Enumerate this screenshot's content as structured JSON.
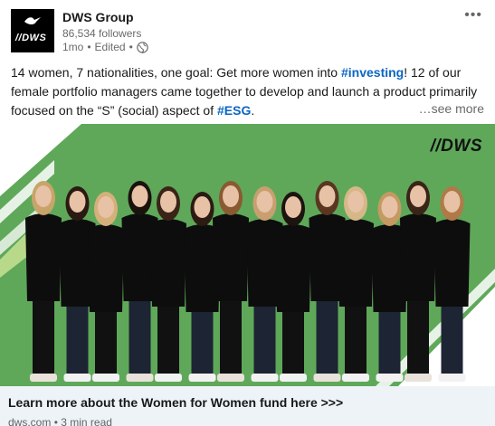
{
  "author": {
    "name": "DWS Group",
    "followers": "86,534 followers",
    "time": "1mo",
    "edited": "Edited",
    "separator": "•",
    "logo_text": "//DWS"
  },
  "post": {
    "text_1": "14 women, 7 nationalities, one goal: Get more women into ",
    "hashtag_1": "#investing",
    "text_2": "! 12 of our female portfolio managers came together to develop and launch a product primarily focused on the “S” (social) aspect of ",
    "hashtag_2": "#ESG",
    "text_3": ".",
    "see_more": "…see more"
  },
  "image": {
    "brand_text": "//DWS",
    "people_count": 14,
    "background_color": "#5fa85a"
  },
  "link": {
    "title": "Learn more about the Women for Women fund here >>>",
    "source": "dws.com",
    "separator": "•",
    "read_time": "3 min read"
  },
  "colors": {
    "hashtag": "#0a66c2",
    "link_bar": "#eef3f8"
  },
  "icons": [
    "more-menu-icon",
    "globe-icon",
    "dws-bird-icon"
  ]
}
